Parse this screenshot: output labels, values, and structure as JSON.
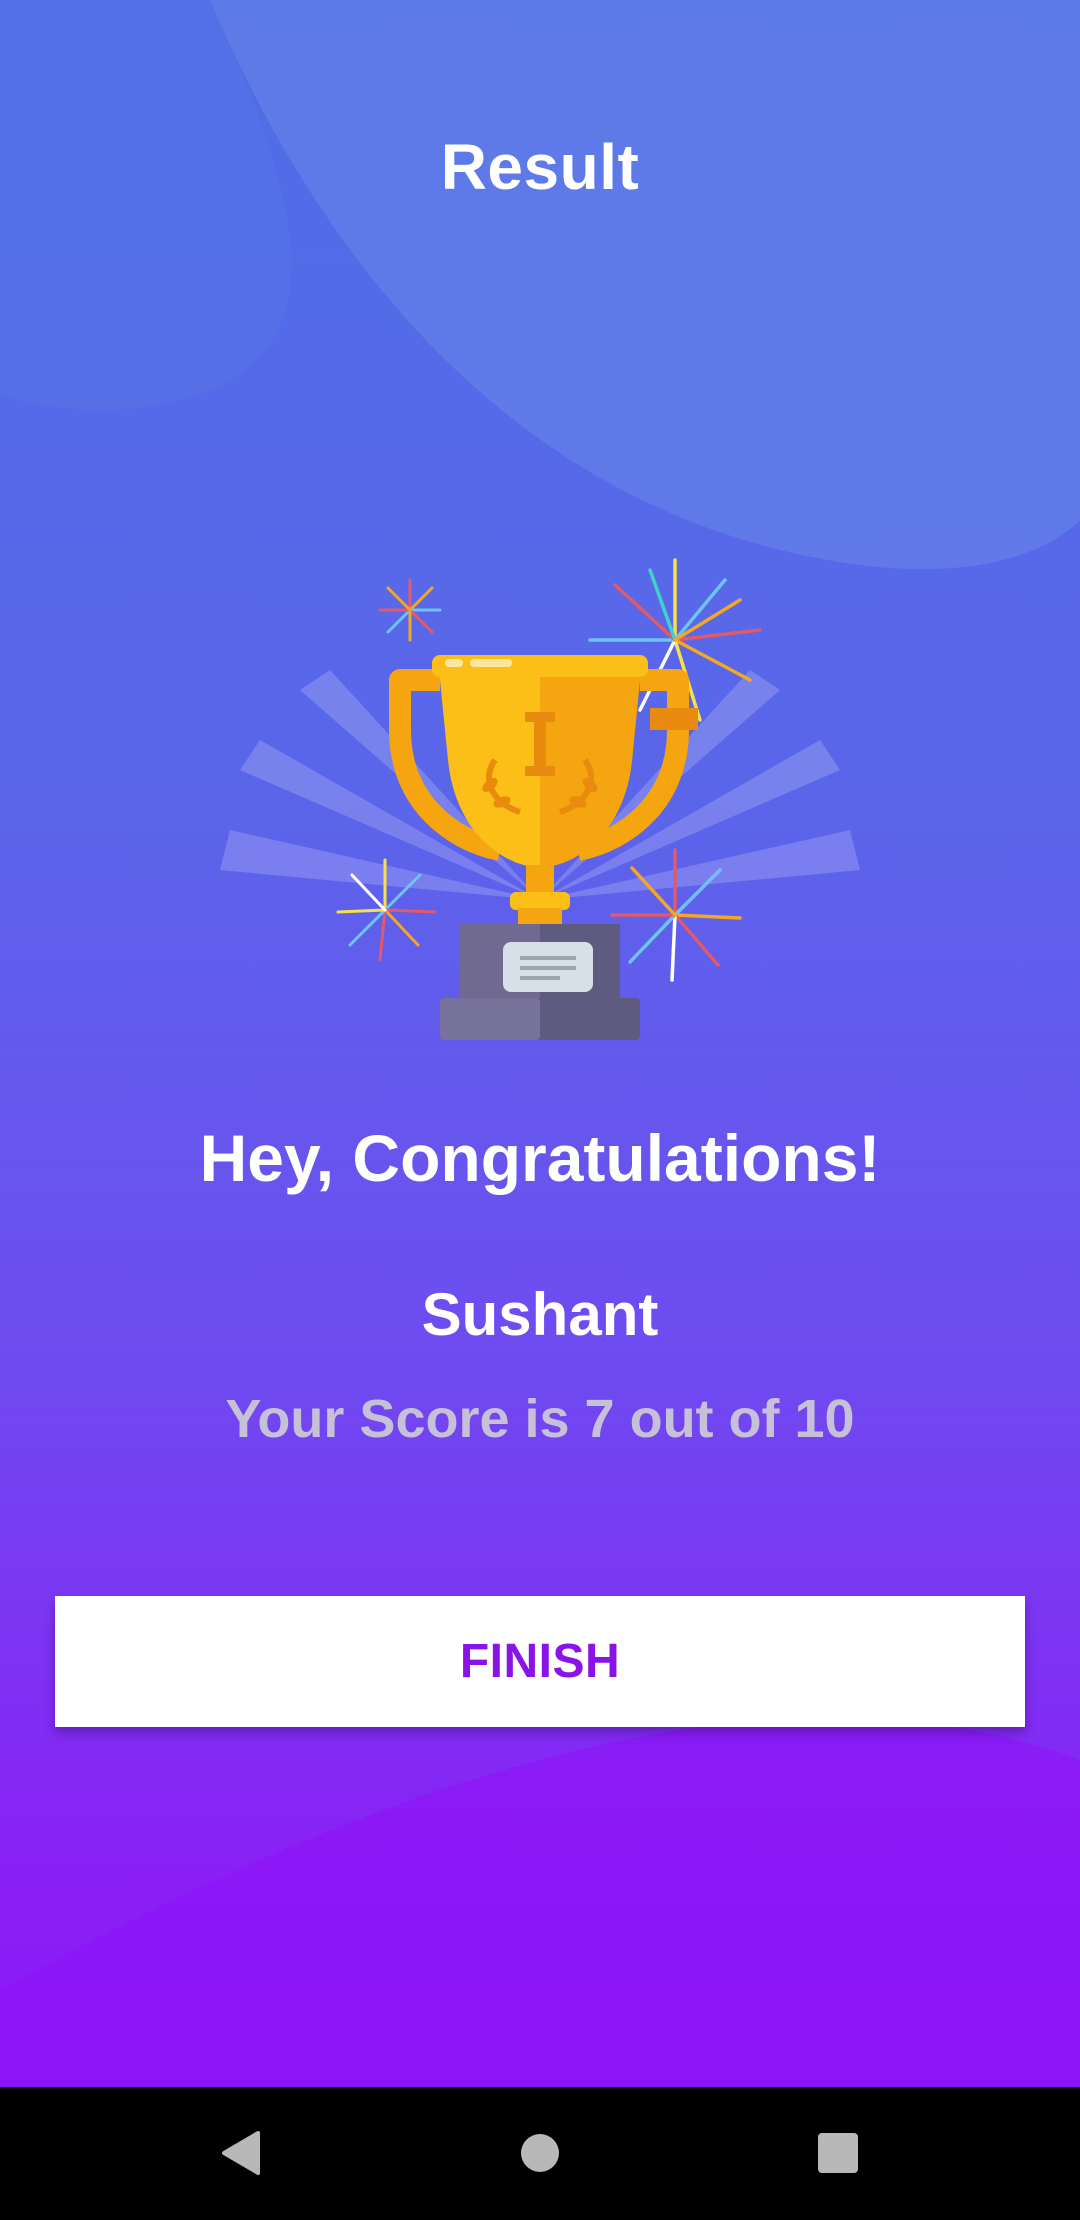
{
  "header": {
    "title": "Result"
  },
  "result": {
    "congrats_text": "Hey, Congratulations!",
    "user_name": "Sushant",
    "score_text": "Your Score is 7 out of 10"
  },
  "actions": {
    "finish_label": "FINISH"
  },
  "navbar": {
    "back_icon": "back-triangle-icon",
    "home_icon": "home-circle-icon",
    "recents_icon": "recents-square-icon"
  },
  "colors": {
    "bg_top": "#4f6ee6",
    "bg_bottom": "#8c16f6",
    "button_text": "#8a14e8",
    "score_text": "#c6c0d8",
    "trophy_gold": "#fbbf17"
  }
}
